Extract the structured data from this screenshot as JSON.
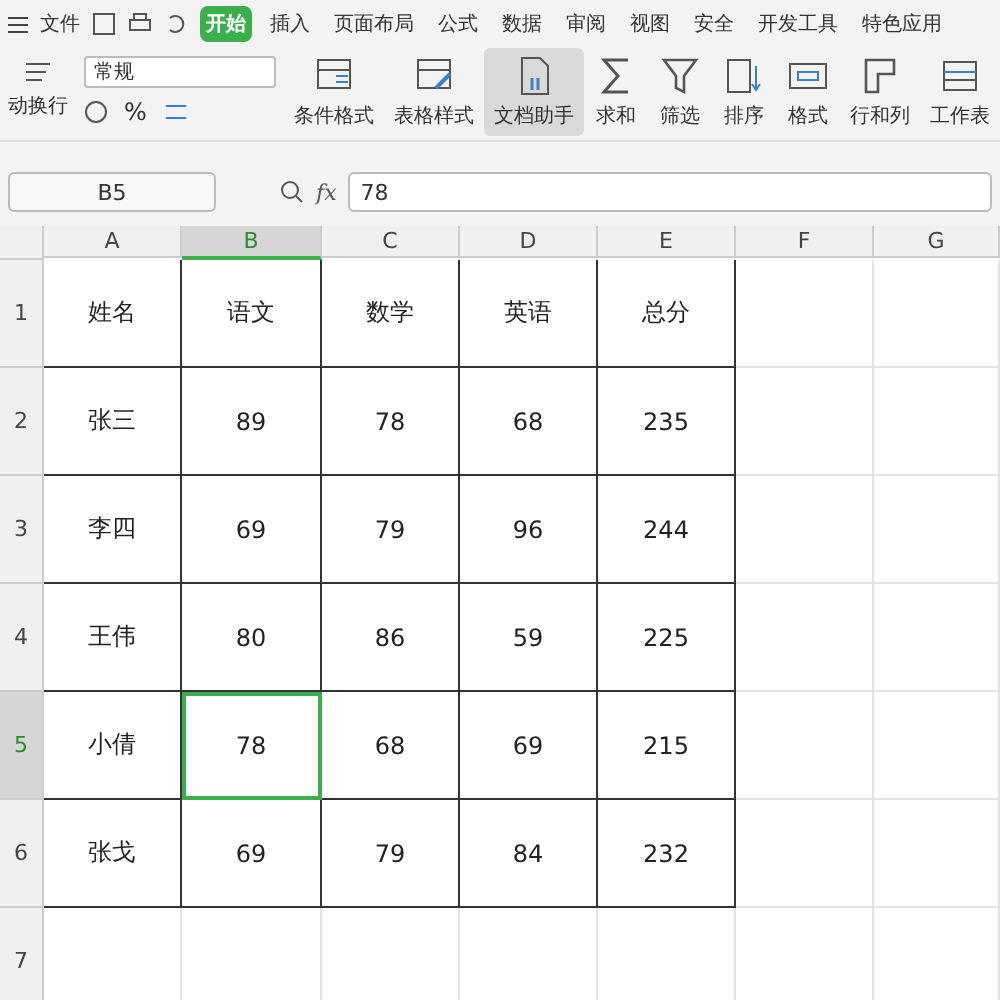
{
  "menu": {
    "file": "文件",
    "tabs": [
      {
        "label": "开始",
        "selected": true
      },
      {
        "label": "插入",
        "selected": false
      },
      {
        "label": "页面布局",
        "selected": false
      },
      {
        "label": "公式",
        "selected": false
      },
      {
        "label": "数据",
        "selected": false
      },
      {
        "label": "审阅",
        "selected": false
      },
      {
        "label": "视图",
        "selected": false
      },
      {
        "label": "安全",
        "selected": false
      },
      {
        "label": "开发工具",
        "selected": false
      },
      {
        "label": "特色应用",
        "selected": false
      }
    ]
  },
  "ribbon": {
    "wrap_label": "动换行",
    "number_format": "常规",
    "format_buttons": [
      "%"
    ],
    "buttons": [
      {
        "label": "条件格式",
        "kind": "conditional",
        "pressed": false
      },
      {
        "label": "表格样式",
        "kind": "style",
        "pressed": false
      },
      {
        "label": "文档助手",
        "kind": "doc",
        "pressed": true
      },
      {
        "label": "求和",
        "kind": "sum",
        "pressed": false
      },
      {
        "label": "筛选",
        "kind": "filter",
        "pressed": false
      },
      {
        "label": "排序",
        "kind": "sort",
        "pressed": false
      },
      {
        "label": "格式",
        "kind": "format",
        "pressed": false
      },
      {
        "label": "行和列",
        "kind": "rowcol",
        "pressed": false
      },
      {
        "label": "工作表",
        "kind": "sheet",
        "pressed": false
      }
    ]
  },
  "formula_bar": {
    "name_box": "B5",
    "fx": "fx",
    "value": "78"
  },
  "columns": [
    {
      "label": "A",
      "selected": false
    },
    {
      "label": "B",
      "selected": true
    },
    {
      "label": "C",
      "selected": false
    },
    {
      "label": "D",
      "selected": false
    },
    {
      "label": "E",
      "selected": false
    },
    {
      "label": "F",
      "selected": false
    },
    {
      "label": "G",
      "selected": false
    }
  ],
  "rows": [
    {
      "number": "1",
      "selected": false,
      "cells": [
        "姓名",
        "语文",
        "数学",
        "英语",
        "总分"
      ]
    },
    {
      "number": "2",
      "selected": false,
      "cells": [
        "张三",
        "89",
        "78",
        "68",
        "235"
      ]
    },
    {
      "number": "3",
      "selected": false,
      "cells": [
        "李四",
        "69",
        "79",
        "96",
        "244"
      ]
    },
    {
      "number": "4",
      "selected": false,
      "cells": [
        "王伟",
        "80",
        "86",
        "59",
        "225"
      ]
    },
    {
      "number": "5",
      "selected": true,
      "cells": [
        "小倩",
        "78",
        "68",
        "69",
        "215"
      ]
    },
    {
      "number": "6",
      "selected": false,
      "cells": [
        "张戈",
        "69",
        "79",
        "84",
        "232"
      ]
    },
    {
      "number": "7",
      "selected": false,
      "cells": []
    }
  ]
}
